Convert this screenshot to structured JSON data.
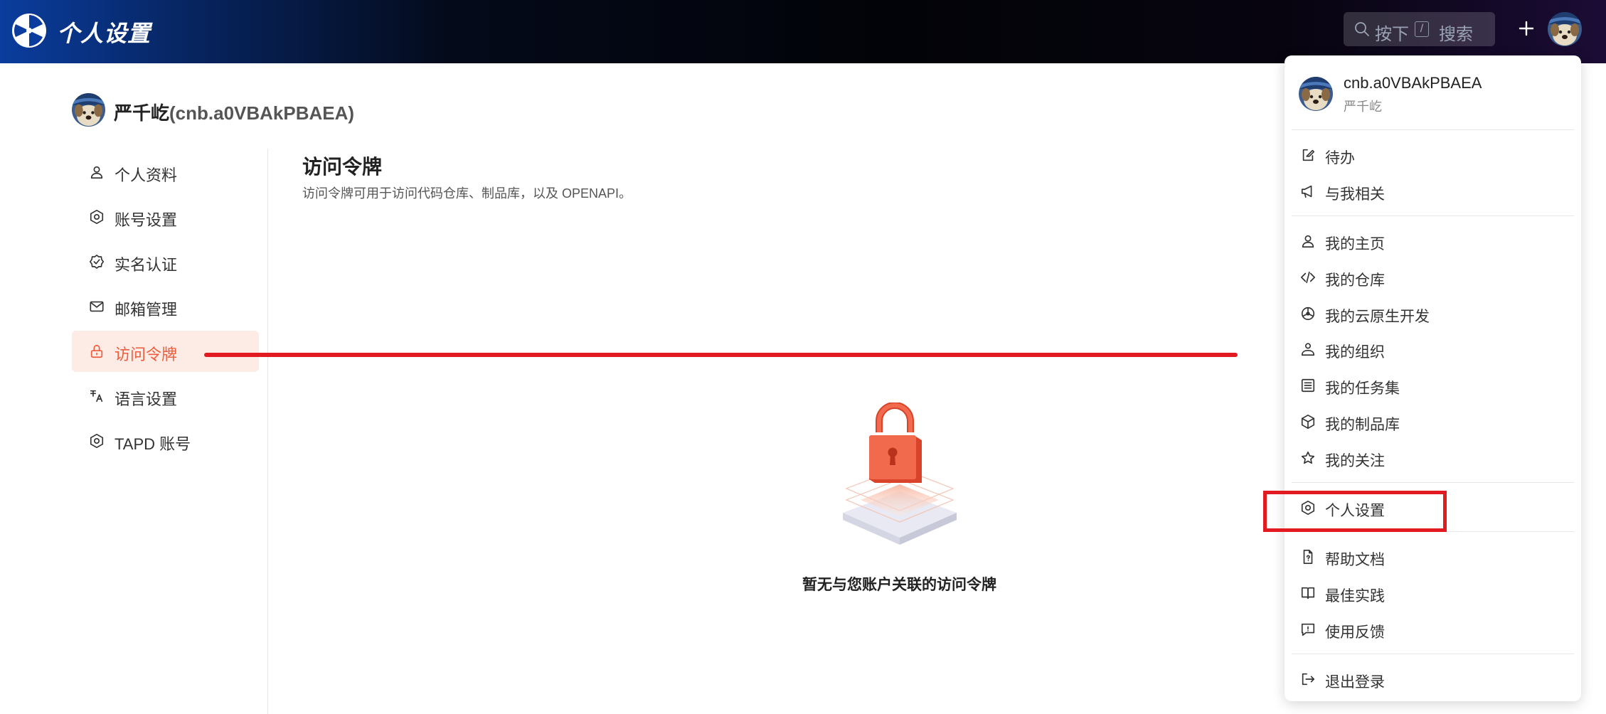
{
  "header": {
    "app_title": "个人设置",
    "search": {
      "prefix": "按下",
      "key": "/",
      "suffix": "搜索"
    },
    "brand_color": "#0a3d9e"
  },
  "profile": {
    "display_name": "严千屹",
    "account": "(cnb.a0VBAkPBAEA)"
  },
  "sidenav": {
    "items": [
      {
        "label": "个人资料",
        "icon": "user-icon"
      },
      {
        "label": "账号设置",
        "icon": "hexagon-settings-icon"
      },
      {
        "label": "实名认证",
        "icon": "verified-badge-icon"
      },
      {
        "label": "邮箱管理",
        "icon": "mail-icon"
      },
      {
        "label": "访问令牌",
        "icon": "lock-icon",
        "active": true
      },
      {
        "label": "语言设置",
        "icon": "translate-icon"
      },
      {
        "label": "TAPD 账号",
        "icon": "hexagon-settings-icon"
      }
    ],
    "active_color": "#ee5c3c"
  },
  "main": {
    "title": "访问令牌",
    "description": "访问令牌可用于访问代码仓库、制品库，以及 OPENAPI。",
    "empty_state": "暂无与您账户关联的访问令牌"
  },
  "dropdown": {
    "username": "cnb.a0VBAkPBAEA",
    "display_name": "严千屹",
    "items": [
      {
        "label": "待办",
        "icon": "todo-icon"
      },
      {
        "label": "与我相关",
        "icon": "megaphone-icon"
      },
      {
        "label": "我的主页",
        "icon": "user-icon"
      },
      {
        "label": "我的仓库",
        "icon": "code-icon"
      },
      {
        "label": "我的云原生开发",
        "icon": "pinwheel-icon"
      },
      {
        "label": "我的组织",
        "icon": "group-icon"
      },
      {
        "label": "我的任务集",
        "icon": "list-icon"
      },
      {
        "label": "我的制品库",
        "icon": "package-icon"
      },
      {
        "label": "我的关注",
        "icon": "star-icon"
      },
      {
        "label": "个人设置",
        "icon": "hexagon-settings-icon"
      },
      {
        "label": "帮助文档",
        "icon": "help-doc-icon"
      },
      {
        "label": "最佳实践",
        "icon": "book-icon"
      },
      {
        "label": "使用反馈",
        "icon": "feedback-icon"
      },
      {
        "label": "退出登录",
        "icon": "logout-icon"
      }
    ]
  },
  "annotations": {
    "highlight_color": "#e21b23"
  }
}
